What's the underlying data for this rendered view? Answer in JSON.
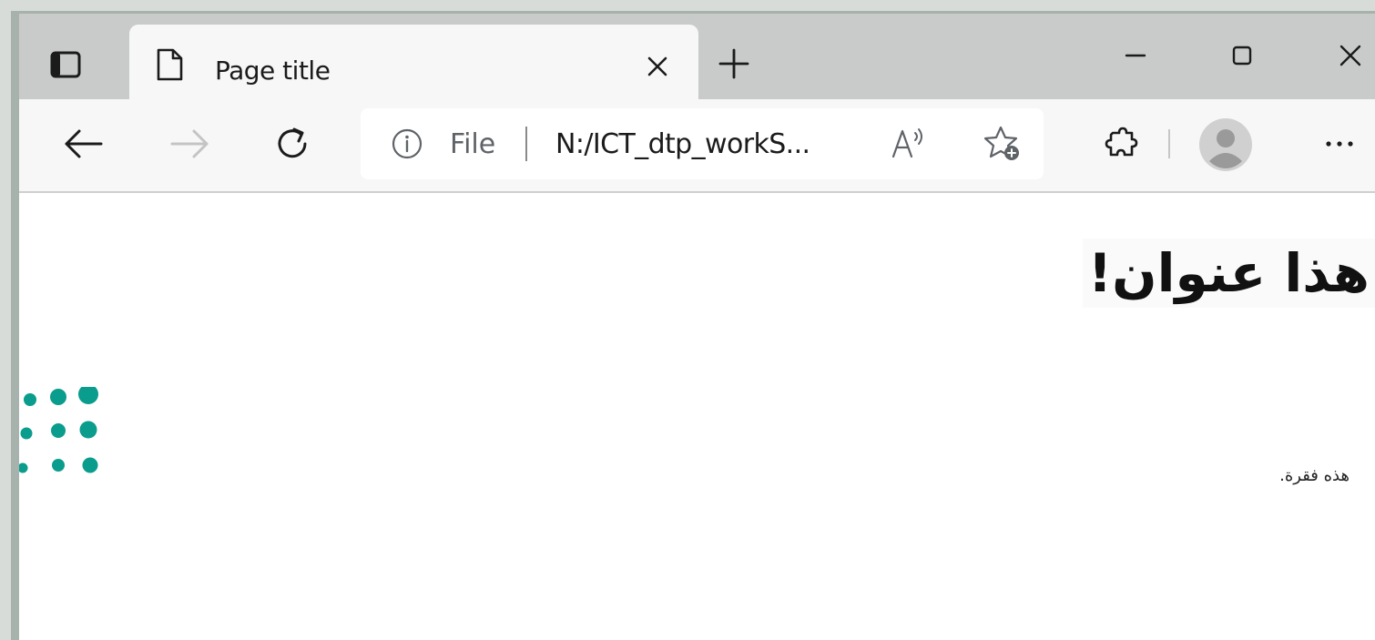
{
  "browser": {
    "tab": {
      "title": "Page title"
    },
    "address_bar": {
      "scheme_label": "File",
      "url": "N:/ICT_dtp_workS..."
    },
    "icons": {
      "tab_actions": "tab-actions-icon",
      "favicon": "page-icon",
      "tab_close": "close-icon",
      "new_tab": "plus-icon",
      "minimize": "minimize-icon",
      "maximize": "maximize-icon",
      "close_window": "close-icon",
      "back": "back-arrow-icon",
      "forward": "forward-arrow-icon",
      "refresh": "refresh-icon",
      "site_info": "info-icon",
      "read_aloud": "read-aloud-icon",
      "add_favorite": "favorite-add-icon",
      "extensions": "extensions-icon",
      "profile": "profile-avatar-icon",
      "more": "more-icon"
    },
    "colors": {
      "tabstrip": "#c8cbca",
      "active_tab": "#f7f7f7",
      "toolbar": "#f7f7f7",
      "frame": "#a8b2ad",
      "logo_teal": "#0a9c8c"
    }
  },
  "page": {
    "heading": "هذا عنوان!",
    "paragraph": "هذه فقرة."
  }
}
